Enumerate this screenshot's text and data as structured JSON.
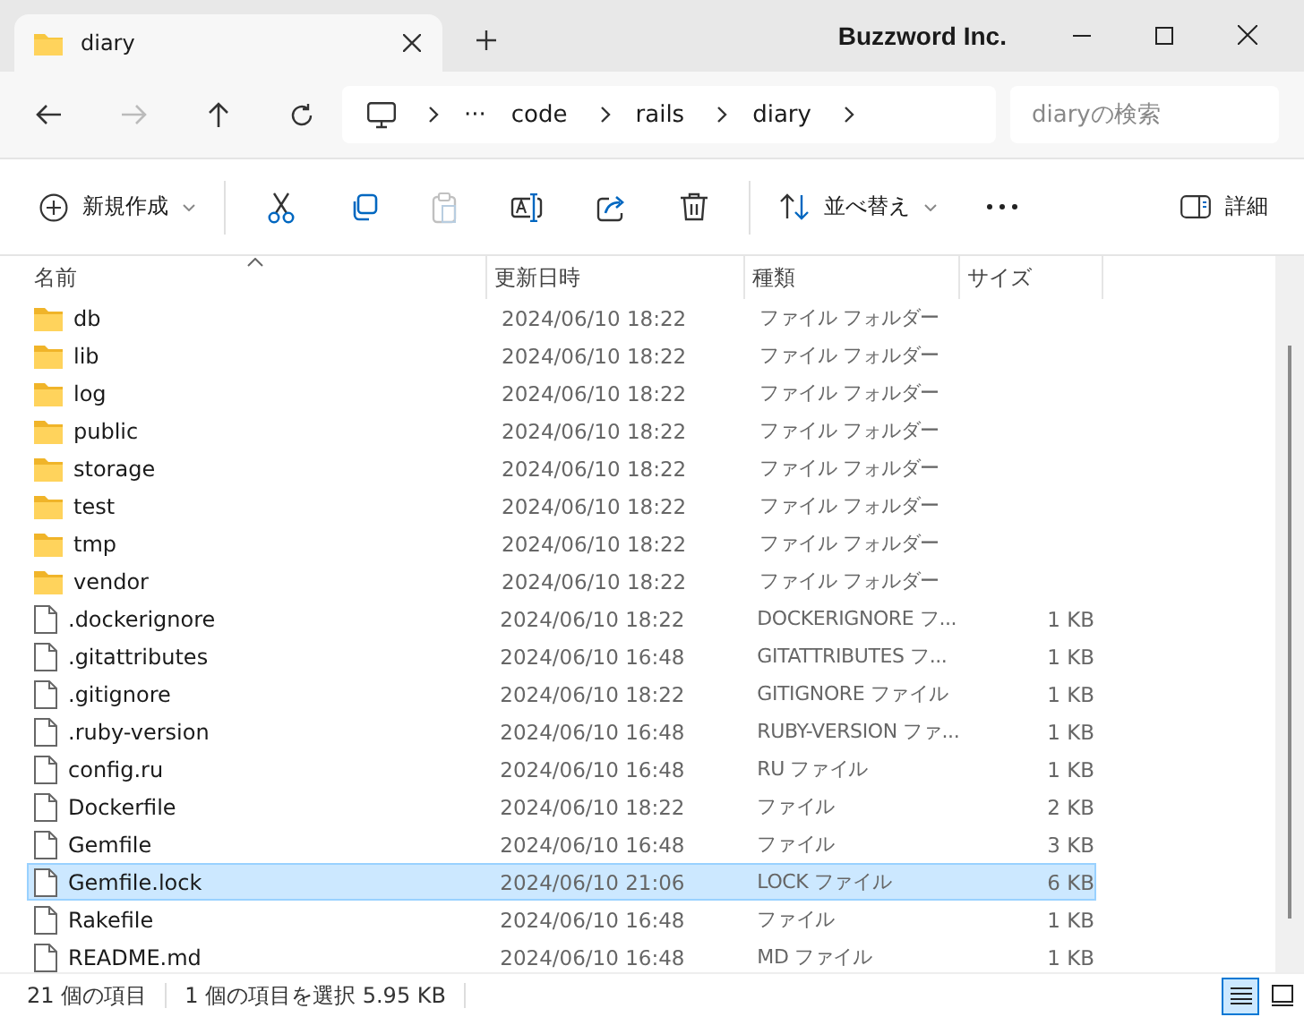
{
  "window": {
    "title": "Buzzword Inc."
  },
  "tab": {
    "label": "diary"
  },
  "nav": {
    "back_disabled": false,
    "forward_disabled": true,
    "up_disabled": false
  },
  "breadcrumb": {
    "overflow": "···",
    "segments": [
      "code",
      "rails",
      "diary"
    ]
  },
  "search": {
    "placeholder": "diaryの検索"
  },
  "toolbar": {
    "new_label": "新規作成",
    "actions": [
      {
        "disabled": false
      },
      {
        "disabled": false
      },
      {
        "disabled": true
      },
      {
        "disabled": false
      },
      {
        "disabled": false
      },
      {
        "disabled": false
      }
    ],
    "sort_label": "並べ替え",
    "details_label": "詳細"
  },
  "table": {
    "columns": [
      "名前",
      "更新日時",
      "種類",
      "サイズ"
    ],
    "rows": [
      {
        "kind": "folder",
        "name": "db",
        "date": "2024/06/10 18:22",
        "type": "ファイル フォルダー",
        "selected": false
      },
      {
        "kind": "folder",
        "name": "lib",
        "date": "2024/06/10 18:22",
        "type": "ファイル フォルダー",
        "selected": false
      },
      {
        "kind": "folder",
        "name": "log",
        "date": "2024/06/10 18:22",
        "type": "ファイル フォルダー",
        "selected": false
      },
      {
        "kind": "folder",
        "name": "public",
        "date": "2024/06/10 18:22",
        "type": "ファイル フォルダー",
        "selected": false
      },
      {
        "kind": "folder",
        "name": "storage",
        "date": "2024/06/10 18:22",
        "type": "ファイル フォルダー",
        "selected": false
      },
      {
        "kind": "folder",
        "name": "test",
        "date": "2024/06/10 18:22",
        "type": "ファイル フォルダー",
        "selected": false
      },
      {
        "kind": "folder",
        "name": "tmp",
        "date": "2024/06/10 18:22",
        "type": "ファイル フォルダー",
        "selected": false
      },
      {
        "kind": "folder",
        "name": "vendor",
        "date": "2024/06/10 18:22",
        "type": "ファイル フォルダー",
        "selected": false
      },
      {
        "kind": "file",
        "name": ".dockerignore",
        "date": "2024/06/10 18:22",
        "type": "DOCKERIGNORE フ...",
        "size": "1 KB",
        "selected": false
      },
      {
        "kind": "file",
        "name": ".gitattributes",
        "date": "2024/06/10 16:48",
        "type": "GITATTRIBUTES フ...",
        "size": "1 KB",
        "selected": false
      },
      {
        "kind": "file",
        "name": ".gitignore",
        "date": "2024/06/10 18:22",
        "type": "GITIGNORE ファイル",
        "size": "1 KB",
        "selected": false
      },
      {
        "kind": "file",
        "name": ".ruby-version",
        "date": "2024/06/10 16:48",
        "type": "RUBY-VERSION ファ...",
        "size": "1 KB",
        "selected": false
      },
      {
        "kind": "file",
        "name": "config.ru",
        "date": "2024/06/10 16:48",
        "type": "RU ファイル",
        "size": "1 KB",
        "selected": false
      },
      {
        "kind": "file",
        "name": "Dockerfile",
        "date": "2024/06/10 18:22",
        "type": "ファイル",
        "size": "2 KB",
        "selected": false
      },
      {
        "kind": "file",
        "name": "Gemfile",
        "date": "2024/06/10 16:48",
        "type": "ファイル",
        "size": "3 KB",
        "selected": false
      },
      {
        "kind": "file",
        "name": "Gemfile.lock",
        "date": "2024/06/10 21:06",
        "type": "LOCK ファイル",
        "size": "6 KB",
        "selected": true
      },
      {
        "kind": "file",
        "name": "Rakefile",
        "date": "2024/06/10 16:48",
        "type": "ファイル",
        "size": "1 KB",
        "selected": false
      },
      {
        "kind": "file",
        "name": "README.md",
        "date": "2024/06/10 16:48",
        "type": "MD ファイル",
        "size": "1 KB",
        "selected": false
      }
    ]
  },
  "status_bar": {
    "count": "21 個の項目",
    "selection": "1 個の項目を選択  5.95 KB",
    "views": [
      {
        "selected": true
      },
      {
        "selected": false
      }
    ]
  }
}
